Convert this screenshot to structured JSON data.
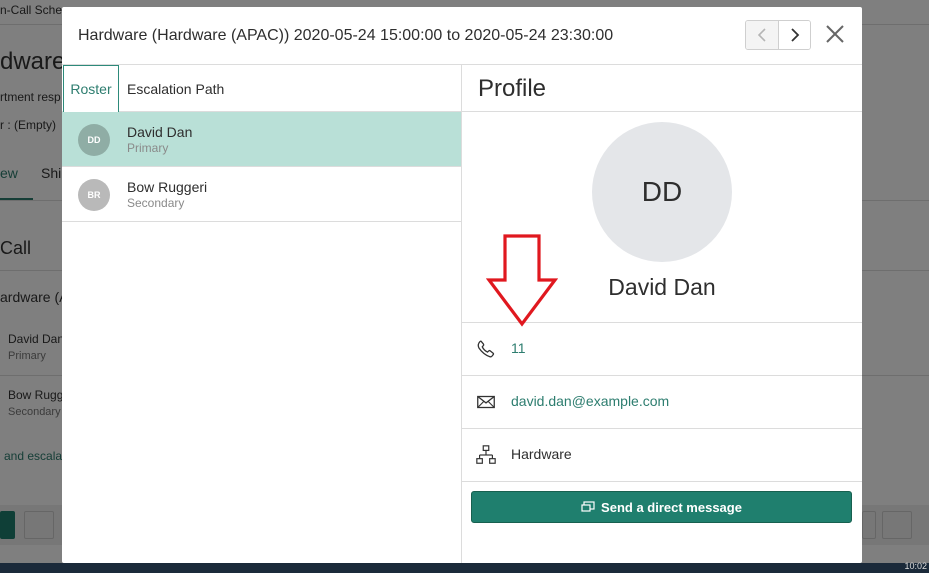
{
  "background": {
    "breadcrumb_fragment": "n-Call Sche",
    "heading_fragment": "dware",
    "desc_fragment": "rtment resp",
    "filter_fragment": "r : (Empty)",
    "tab_fragment_1": "ew",
    "tab_fragment_2": "Shi",
    "section_fragment": "Call",
    "group_fragment": "ardware (A",
    "person1_name": "David Dan",
    "person1_role": "Primary",
    "person2_name": "Bow Rugg",
    "person2_role": "Secondary",
    "link_fragment": "and escala",
    "clock": "10:02"
  },
  "modal": {
    "title": "Hardware (Hardware (APAC)) 2020-05-24 15:00:00 to 2020-05-24 23:30:00",
    "tabs": [
      {
        "label": "Roster"
      },
      {
        "label": "Escalation Path"
      }
    ],
    "roster": [
      {
        "initials": "DD",
        "name": "David Dan",
        "role": "Primary"
      },
      {
        "initials": "BR",
        "name": "Bow Ruggeri",
        "role": "Secondary"
      }
    ],
    "profile": {
      "title": "Profile",
      "initials": "DD",
      "name": "David Dan",
      "phone": "11",
      "email": "david.dan@example.com",
      "group": "Hardware",
      "message_label": "Send a direct message"
    }
  },
  "colors": {
    "accent": "#1f7f6e",
    "selected_row": "#b9e0d7",
    "annotation": "#e0181f"
  }
}
